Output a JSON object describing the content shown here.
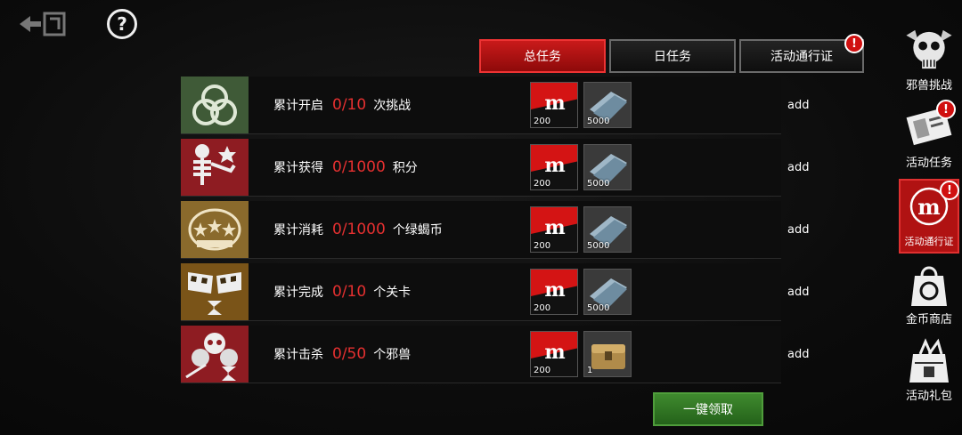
{
  "tabs": [
    {
      "label": "总任务",
      "active": true
    },
    {
      "label": "日任务",
      "active": false
    },
    {
      "label": "活动通行证",
      "active": false,
      "alert": "!"
    }
  ],
  "tasks": [
    {
      "prefix": "累计开启",
      "progress": "0/10",
      "suffix": "次挑战",
      "badge_icon": "biohazard-rings-icon",
      "rewards": [
        {
          "icon": "red-coin-icon",
          "count": "200"
        },
        {
          "icon": "cash-bundle-icon",
          "count": "5000"
        }
      ],
      "action": "add"
    },
    {
      "prefix": "累计获得",
      "progress": "0/1000",
      "suffix": "积分",
      "badge_icon": "skeleton-icon",
      "rewards": [
        {
          "icon": "red-coin-icon",
          "count": "200"
        },
        {
          "icon": "cash-bundle-icon",
          "count": "5000"
        }
      ],
      "action": "add"
    },
    {
      "prefix": "累计消耗",
      "progress": "0/1000",
      "suffix": "个绿蝎币",
      "badge_icon": "passed-stars-icon",
      "rewards": [
        {
          "icon": "red-coin-icon",
          "count": "200"
        },
        {
          "icon": "cash-bundle-icon",
          "count": "5000"
        }
      ],
      "action": "add"
    },
    {
      "prefix": "累计完成",
      "progress": "0/10",
      "suffix": "个关卡",
      "badge_icon": "checkered-flags-icon",
      "rewards": [
        {
          "icon": "red-coin-icon",
          "count": "200"
        },
        {
          "icon": "cash-bundle-icon",
          "count": "5000"
        }
      ],
      "action": "add"
    },
    {
      "prefix": "累计击杀",
      "progress": "0/50",
      "suffix": "个邪兽",
      "badge_icon": "skulls-icon",
      "rewards": [
        {
          "icon": "red-coin-icon",
          "count": "200"
        },
        {
          "icon": "gold-chest-icon",
          "count": "1"
        }
      ],
      "action": "add"
    }
  ],
  "claim_all": "一键领取",
  "sidebar": [
    {
      "label": "邪兽挑战",
      "icon": "skull-emblem-icon"
    },
    {
      "label": "活动任务",
      "icon": "ticket-icon",
      "alert": "!"
    },
    {
      "label": "活动通行证",
      "icon": "scorpio-icon",
      "selected": true,
      "alert": "!"
    },
    {
      "label": "金币商店",
      "icon": "shopping-bag-icon"
    },
    {
      "label": "活动礼包",
      "icon": "gift-bag-icon"
    }
  ],
  "header": {
    "back_icon": "back-arrow-icon",
    "help_symbol": "?"
  },
  "colors": {
    "accent_red": "#c91a1a",
    "progress_red": "#e53030",
    "claim_green": "#3f8a2e"
  }
}
